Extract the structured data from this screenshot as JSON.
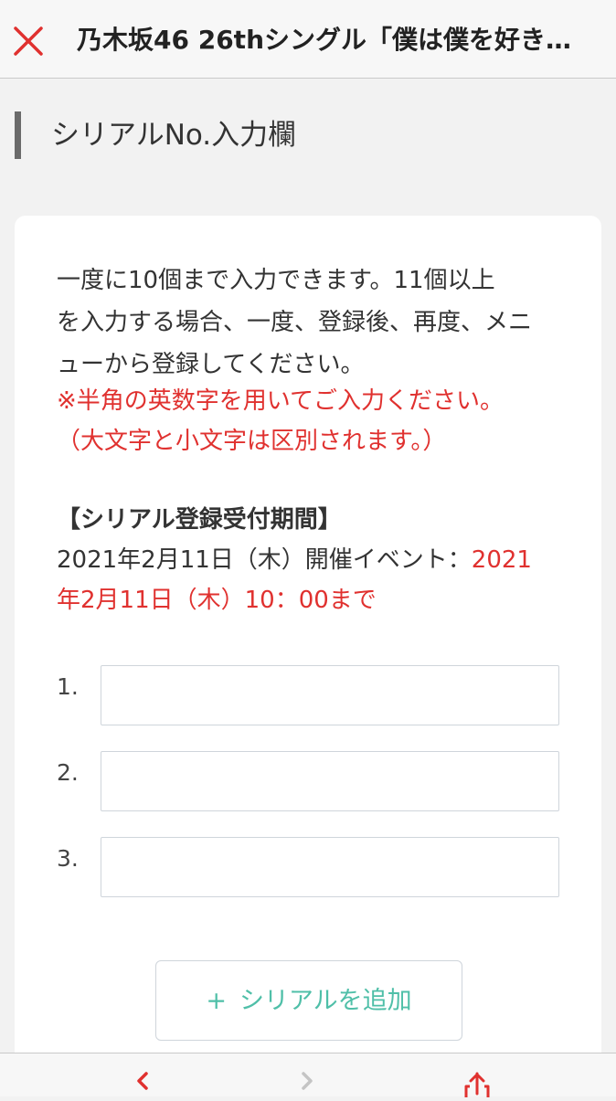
{
  "header": {
    "title": "乃木坂46 26thシングル「僕は僕を好き…",
    "close_icon": "close-icon",
    "close_color": "#e0312f"
  },
  "section": {
    "title": "シリアルNo.入力欄"
  },
  "instructions": {
    "line1": "一度に10個まで入力できます。11個以上",
    "line2": "を入力する場合、一度、登録後、再度、メニ",
    "line3": "ューから登録してください。",
    "note1": "※半角の英数字を用いてご入力ください。",
    "note2": "（大文字と小文字は区別されます。）"
  },
  "period": {
    "heading": "【シリアル登録受付期間】",
    "event_text": "2021年2月11日（木）開催イベント：",
    "deadline_part1": "2021",
    "deadline_part2": "年2月11日（木）10：00まで"
  },
  "serials": [
    {
      "number": "1.",
      "value": ""
    },
    {
      "number": "2.",
      "value": ""
    },
    {
      "number": "3.",
      "value": ""
    }
  ],
  "add_button": {
    "plus": "+",
    "label": "シリアルを追加"
  },
  "toolbar": {
    "back_icon": "chevron-left-icon",
    "forward_icon": "chevron-right-icon",
    "share_icon": "share-icon"
  },
  "colors": {
    "accent_red": "#e0312f",
    "accent_teal": "#4fbfa8"
  }
}
